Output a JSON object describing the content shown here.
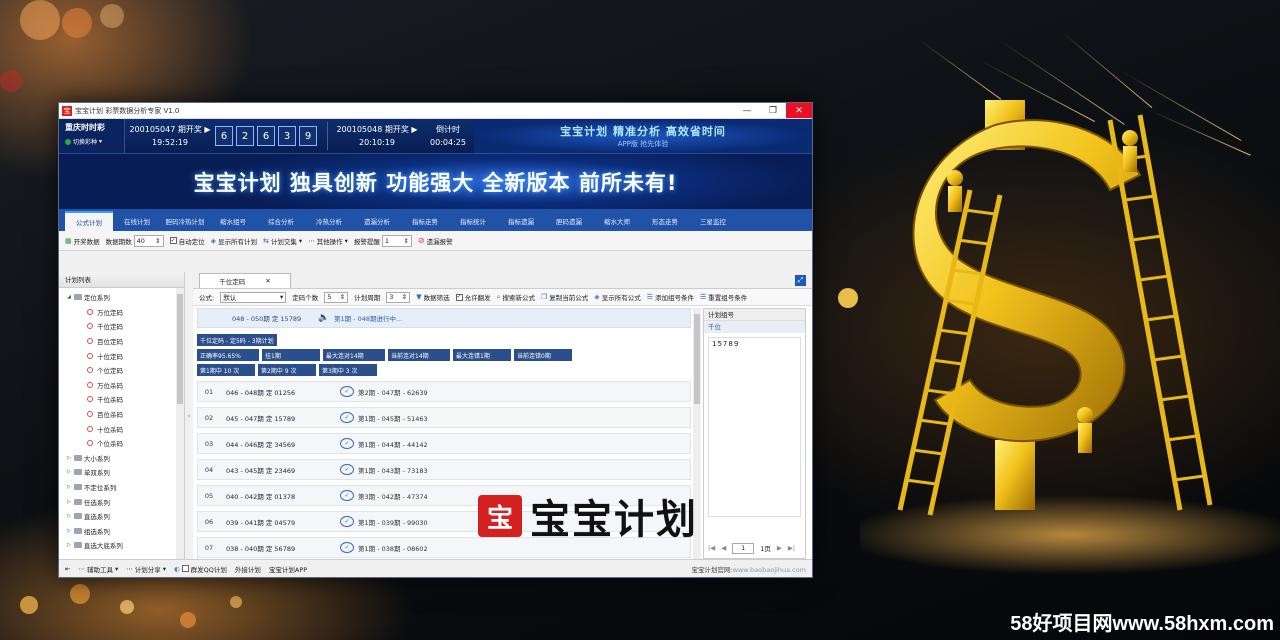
{
  "window": {
    "title": "宝宝计划 彩票数据分析专家 V1.0",
    "app_icon": "宝",
    "min_glyph": "—",
    "restore_glyph": "❐",
    "close_glyph": "✕"
  },
  "header": {
    "lottery_name": "重庆时时彩",
    "switch_label": "切换彩种",
    "last_draw": {
      "label": "200105047 期开奖",
      "time": "19:52:19",
      "numbers": [
        "6",
        "2",
        "6",
        "3",
        "9"
      ]
    },
    "next_draw": {
      "label": "200105048 期开奖",
      "time": "20:10:19"
    },
    "countdown": {
      "label": "倒计时",
      "value": "00:04:25"
    },
    "banner_line1": "宝宝计划  精准分析  高效省时间",
    "banner_line2": "APP版 抢先体验"
  },
  "hero_banner": "宝宝计划 独具创新 功能强大  全新版本 前所未有!",
  "nav_tabs": [
    "公式计划",
    "在线计划",
    "胆码冷热计划",
    "缩水组号",
    "综合分析",
    "冷热分析",
    "遗漏分析",
    "指标走势",
    "指标统计",
    "指标遗漏",
    "胆码遗漏",
    "缩水大师",
    "形态走势",
    "三星监控"
  ],
  "toolbar": {
    "lottery_data": "开奖数据",
    "data_periods_label": "数据期数",
    "data_periods_value": "40",
    "auto_position": "自动定位",
    "show_all_plans": "显示所有计划",
    "plan_exchange": "计划交集",
    "other_ops": "其他操作",
    "alert_label": "报警提醒",
    "alert_value": "1",
    "miss_alert": "遗漏报警"
  },
  "left_panel": {
    "title": "计划列表",
    "groups": [
      {
        "label": "定位系列",
        "expanded": true,
        "children": [
          "万位定码",
          "千位定码",
          "百位定码",
          "十位定码",
          "个位定码",
          "万位杀码",
          "千位杀码",
          "百位杀码",
          "十位杀码",
          "个位杀码"
        ]
      },
      {
        "label": "大小系列"
      },
      {
        "label": "单双系列"
      },
      {
        "label": "不定位系列"
      },
      {
        "label": "任选系列"
      },
      {
        "label": "直选系列"
      },
      {
        "label": "组选系列"
      },
      {
        "label": "直选大底系列"
      }
    ]
  },
  "main": {
    "tab_label": "千位定码",
    "tab_close": "✕",
    "formula_label": "公式:",
    "formula_value": "默认",
    "code_count_label": "定码个数",
    "code_count_value": "5",
    "cycle_label": "计划周期",
    "cycle_value": "3",
    "data_filter": "数据筛选",
    "allow_double": "允许翻发",
    "search_formula": "搜索新公式",
    "copy_formula": "复制当前公式",
    "show_formulas": "显示所有公式",
    "add_condition": "添加组号条件",
    "reset_condition": "重置组号条件",
    "current": {
      "range": "048 - 050期 定 15789",
      "status": "第1期 - 048期进行中..."
    },
    "stat_rows": [
      [
        "千位定码 - 定5码 - 3期计划"
      ],
      [
        "正确率95.65%",
        "挂1期",
        "最大连对14期",
        "当前连对14期",
        "最大连错1期",
        "当前连错0期"
      ],
      [
        "第1期中 10 次",
        "第2期中 9 次",
        "第3期中 3 次"
      ]
    ],
    "history": [
      {
        "idx": "01",
        "range": "046 - 048期  定  01256",
        "result": "第2期 - 047期 - 62639"
      },
      {
        "idx": "02",
        "range": "045 - 047期  定  15789",
        "result": "第1期 - 045期 - 51463"
      },
      {
        "idx": "03",
        "range": "044 - 046期  定  34569",
        "result": "第1期 - 044期 - 44142"
      },
      {
        "idx": "04",
        "range": "043 - 045期  定  23469",
        "result": "第1期 - 043期 - 73183"
      },
      {
        "idx": "05",
        "range": "040 - 042期  定  01378",
        "result": "第3期 - 042期 - 47374"
      },
      {
        "idx": "06",
        "range": "039 - 041期  定  04579",
        "result": "第1期 - 039期 - 99030"
      },
      {
        "idx": "07",
        "range": "038 - 040期  定  56789",
        "result": "第1期 - 038期 - 08602"
      }
    ]
  },
  "right_panel": {
    "title": "计划组号",
    "position_label": "千位",
    "numbers": "15789",
    "page_value": "1",
    "page_total": "1页",
    "nav_first": "|◀",
    "nav_prev": "◀",
    "nav_next": "▶",
    "nav_last": "▶|"
  },
  "statusbar": {
    "aux_tools": "辅助工具",
    "plan_share": "计划分享",
    "group_qq": "群发QQ计划",
    "external_plan": "外接计划",
    "app": "宝宝计划APP",
    "site_label": "宝宝计划官网:",
    "site_url": "www.baobaojihua.com"
  },
  "watermark": {
    "seal": "宝",
    "text": "宝宝计划"
  },
  "footer_mark": "58好项目网www.58hxm.com",
  "colors": {
    "nav_blue": "#2053a8",
    "header_navy": "#0e2d6e",
    "close_red": "#e81123",
    "chip_blue": "#2a4f8c",
    "gold": "#f2c21b"
  },
  "icons": [
    "app-logo-icon",
    "speaker-icon",
    "check-circle-icon",
    "folder-icon",
    "plan-circle-icon",
    "alert-icon",
    "expand-icon"
  ]
}
